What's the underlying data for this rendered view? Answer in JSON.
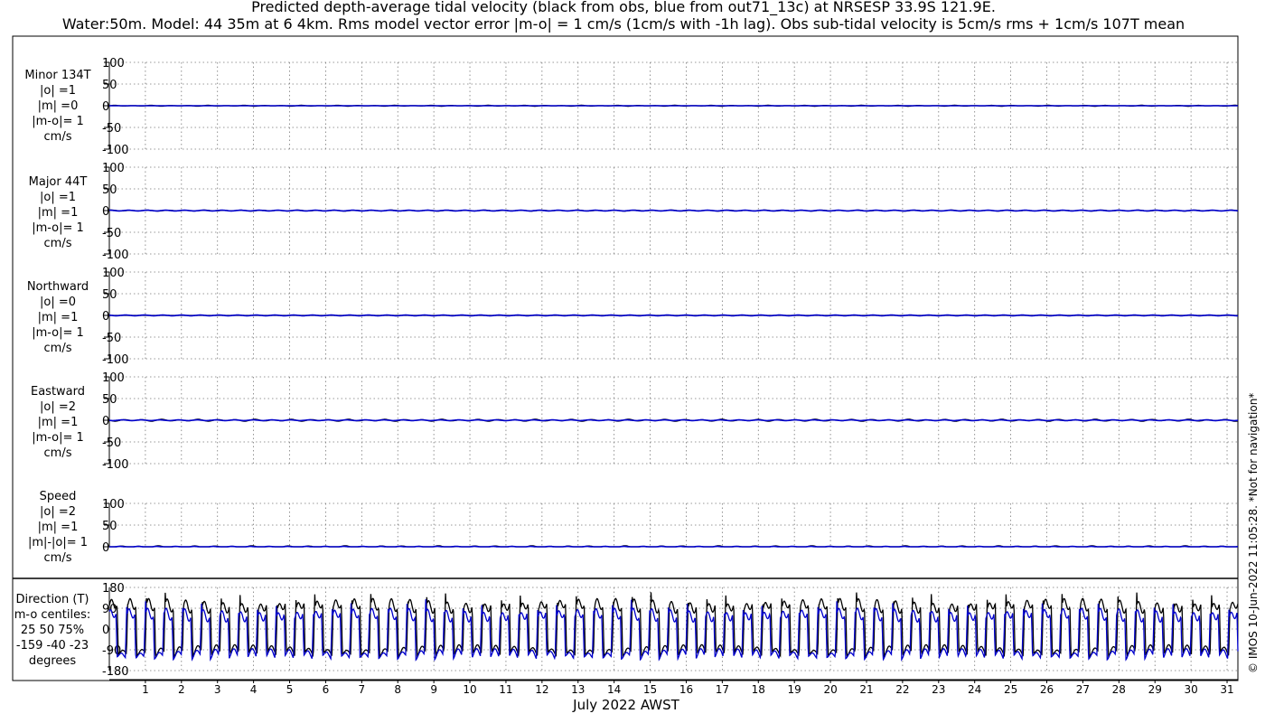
{
  "title_line1": "Predicted depth-average tidal velocity (black from obs, blue from out71_13c) at NRSESP 33.9S 121.9E.",
  "title_line2": "Water:50m. Model: 44 35m at 6 4km. Rms model vector error |m-o| = 1 cm/s (1cm/s with -1h lag). Obs sub-tidal velocity is 5cm/s rms + 1cm/s 107T mean",
  "credit": "© IMOS 10-Jun-2022 11:05:28. *Not for navigation*",
  "colors": {
    "obs": "#000000",
    "model": "#0000cc"
  },
  "chart_data": {
    "type": "line",
    "xlabel": "July 2022 AWST",
    "x_ticks": [
      "1",
      "2",
      "3",
      "4",
      "5",
      "6",
      "7",
      "8",
      "9",
      "10",
      "11",
      "12",
      "13",
      "14",
      "15",
      "16",
      "17",
      "18",
      "19",
      "20",
      "21",
      "22",
      "23",
      "24",
      "25",
      "26",
      "27",
      "28",
      "29",
      "30",
      "31"
    ],
    "xlim": [
      0,
      31.3
    ],
    "series_legend": [
      "black from obs",
      "blue from out71_13c"
    ],
    "panels": [
      {
        "label_lines": [
          "Minor 134T",
          "|o| =1",
          "|m| =0",
          "|m-o|= 1",
          "cm/s"
        ],
        "ylim": [
          -100,
          100
        ],
        "yticks": [
          100,
          50,
          0,
          -50,
          -100
        ],
        "obs_amplitude": 1,
        "model_amplitude": 0
      },
      {
        "label_lines": [
          "Major 44T",
          "|o| =1",
          "|m| =1",
          "|m-o|= 1",
          "cm/s"
        ],
        "ylim": [
          -100,
          100
        ],
        "yticks": [
          100,
          50,
          0,
          -50,
          -100
        ],
        "obs_amplitude": 1,
        "model_amplitude": 1
      },
      {
        "label_lines": [
          "Northward",
          "|o| =0",
          "|m| =1",
          "|m-o|= 1",
          "cm/s"
        ],
        "ylim": [
          -100,
          100
        ],
        "yticks": [
          100,
          50,
          0,
          -50,
          -100
        ],
        "obs_amplitude": 0,
        "model_amplitude": 1
      },
      {
        "label_lines": [
          "Eastward",
          "|o| =2",
          "|m| =1",
          "|m-o|= 1",
          "cm/s"
        ],
        "ylim": [
          -100,
          100
        ],
        "yticks": [
          100,
          50,
          0,
          -50,
          -100
        ],
        "obs_amplitude": 2,
        "model_amplitude": 1
      },
      {
        "label_lines": [
          "Speed",
          "|o| =2",
          "|m| =1",
          "|m|-|o|= 1",
          "cm/s"
        ],
        "ylim": [
          0,
          100
        ],
        "yticks": [
          100,
          50,
          0
        ],
        "obs_amplitude": 2,
        "model_amplitude": 1
      }
    ],
    "direction_panel": {
      "label_lines": [
        "Direction (T)",
        "m-o centiles:",
        "25  50  75%",
        "-159  -40  -23",
        "degrees"
      ],
      "ylim": [
        -180,
        180
      ],
      "yticks": [
        180,
        90,
        0,
        -90,
        -180
      ]
    }
  }
}
